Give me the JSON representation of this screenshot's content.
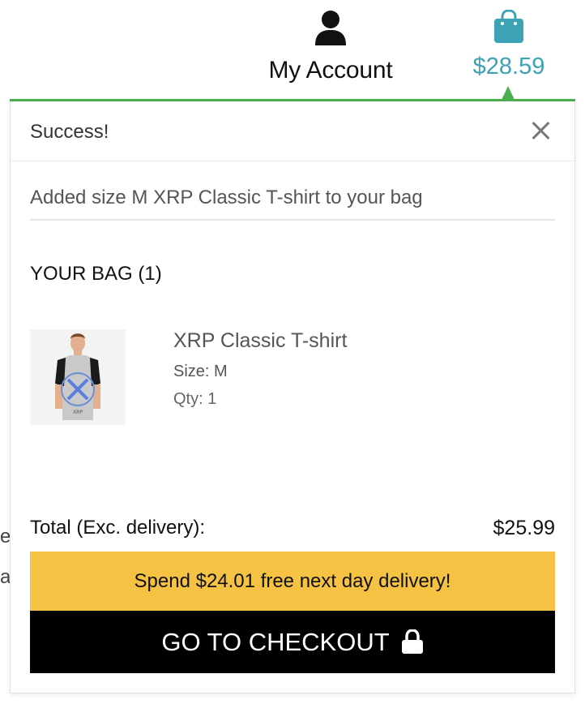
{
  "header": {
    "account_label": "My Account",
    "account_icon": "user-icon",
    "cart_total": "$28.59",
    "cart_icon": "shopping-bag-icon",
    "accent_color": "#3ba3b5"
  },
  "background_fragments": [
    "e",
    "a"
  ],
  "minicart": {
    "status": "Success!",
    "added_message": "Added size M XRP Classic T-shirt to your bag",
    "bag_title": "YOUR BAG (1)",
    "items": [
      {
        "name": "XRP Classic T-shirt",
        "size": "Size: M",
        "qty": "Qty: 1"
      }
    ],
    "total_label": "Total (Exc. delivery):",
    "total_value": "$25.99",
    "promo_text": "Spend $24.01 free next day delivery!",
    "checkout_label": "GO TO CHECKOUT",
    "checkout_icon": "lock-icon",
    "promo_color": "#f5c244",
    "success_line_color": "#4caf50"
  }
}
